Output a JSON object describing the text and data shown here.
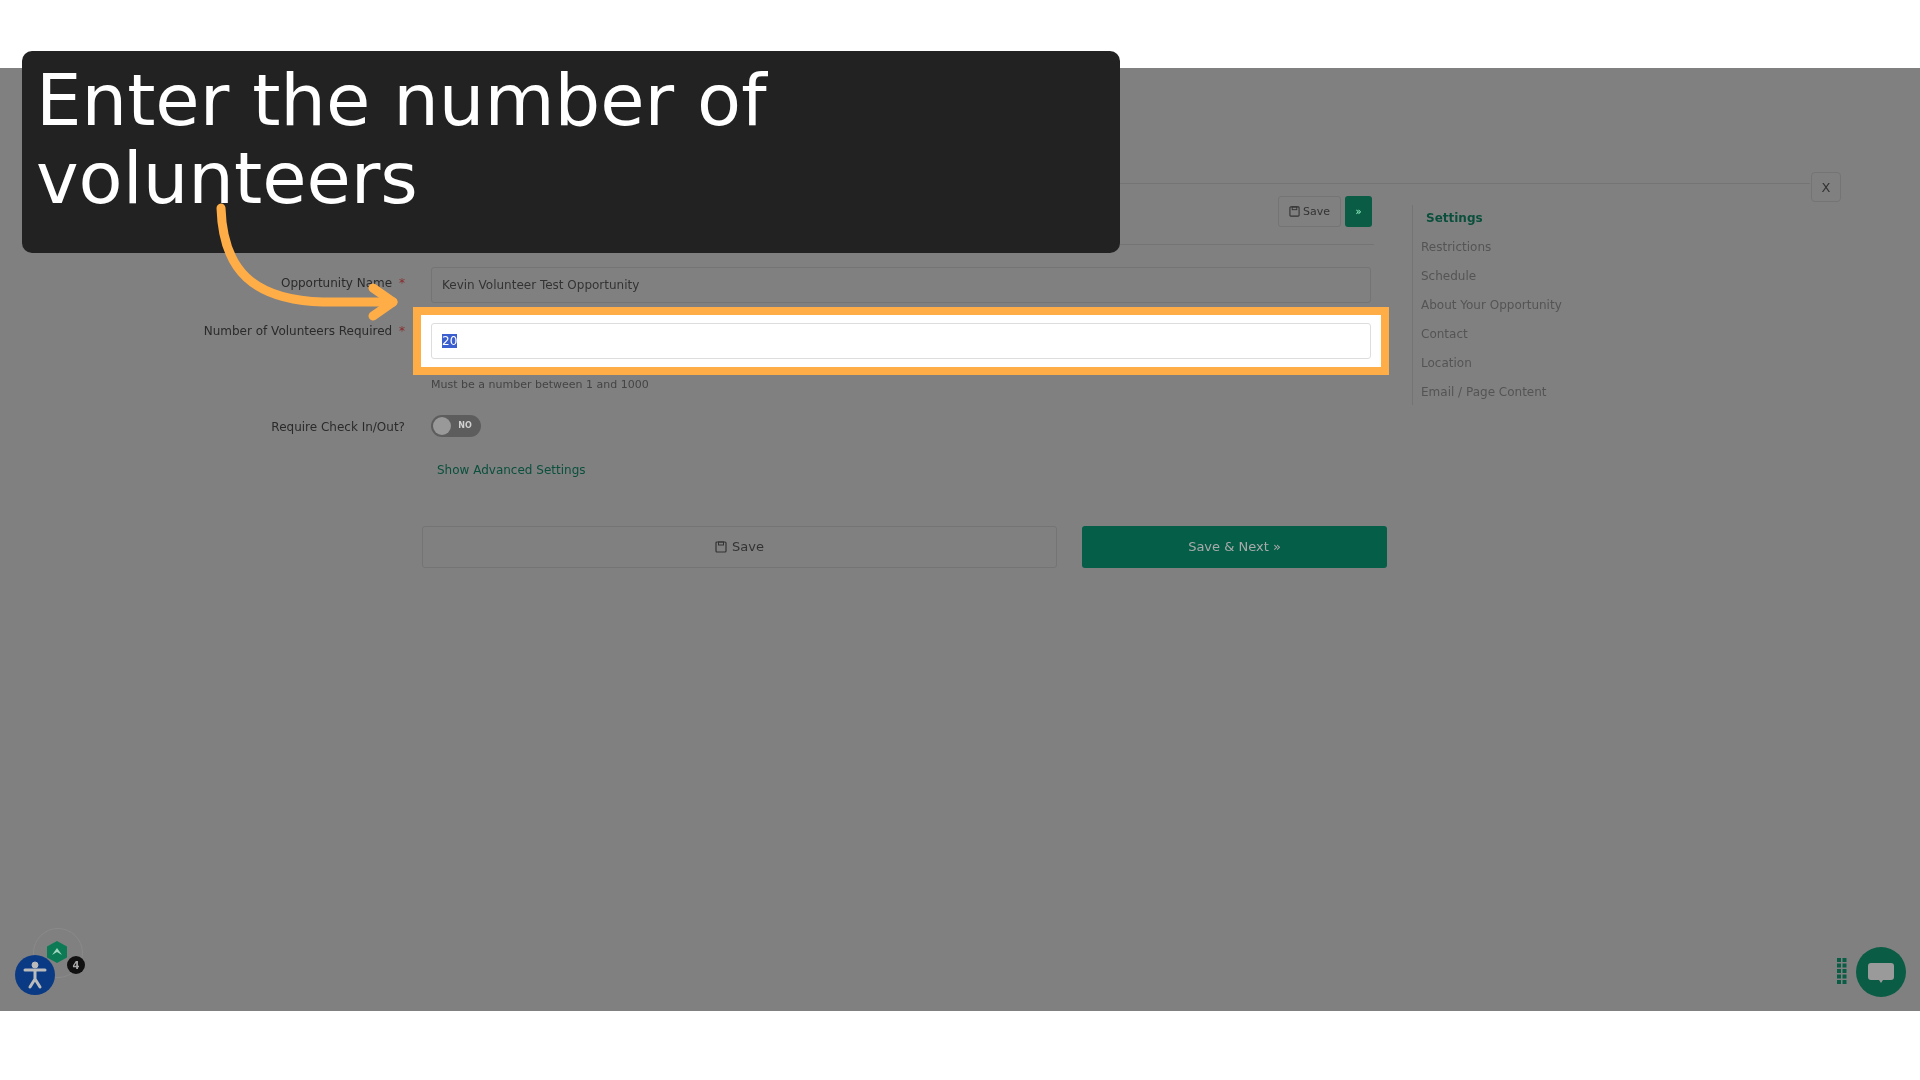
{
  "callout": {
    "text": "Enter the number of volunteers"
  },
  "header": {
    "save_button": "Save",
    "next_button": "»",
    "close_button": "X"
  },
  "fields": [
    {
      "kind": "text",
      "label": "Opportunity Name",
      "required_mark": "*",
      "value": "Kevin Volunteer Test Opportunity",
      "highlighted": false
    },
    {
      "kind": "number",
      "label": "Number of Volunteers Required",
      "required_mark": "*",
      "value": "20",
      "value_selected": true,
      "highlighted": true,
      "helper": "Must be a number between 1 and 1000"
    },
    {
      "kind": "toggle",
      "label": "Require Check In/Out?",
      "on": false,
      "state_text": "NO"
    }
  ],
  "advanced_link": "Show Advanced Settings",
  "buttons": {
    "save": "Save",
    "save_next": "Save & Next »"
  },
  "sidebar": {
    "items": [
      {
        "label": "Settings",
        "selected": true
      },
      {
        "label": "Restrictions",
        "selected": false
      },
      {
        "label": "Schedule",
        "selected": false
      },
      {
        "label": "About Your Opportunity",
        "selected": false
      },
      {
        "label": "Contact",
        "selected": false
      },
      {
        "label": "Location",
        "selected": false
      },
      {
        "label": "Email / Page Content",
        "selected": false
      }
    ]
  },
  "widget": {
    "badge": "4"
  }
}
